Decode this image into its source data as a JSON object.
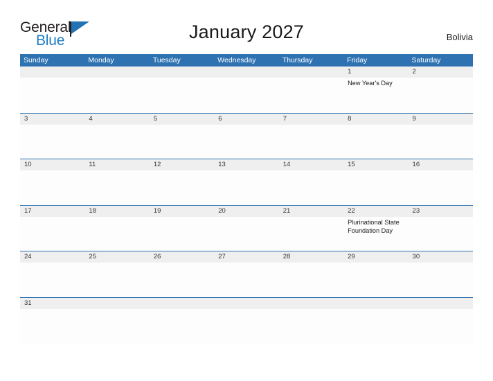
{
  "brand": {
    "name_part1": "General",
    "name_part2": "Blue",
    "colors": {
      "dark": "#231f20",
      "blue": "#1d7dc4"
    }
  },
  "header": {
    "title": "January 2027",
    "country": "Bolivia"
  },
  "calendar": {
    "accent_color": "#2e72b2",
    "number_band_color": "#efefef",
    "weekdays": [
      "Sunday",
      "Monday",
      "Tuesday",
      "Wednesday",
      "Thursday",
      "Friday",
      "Saturday"
    ],
    "weeks": [
      [
        {
          "day": "",
          "event": ""
        },
        {
          "day": "",
          "event": ""
        },
        {
          "day": "",
          "event": ""
        },
        {
          "day": "",
          "event": ""
        },
        {
          "day": "",
          "event": ""
        },
        {
          "day": "1",
          "event": "New Year's Day"
        },
        {
          "day": "2",
          "event": ""
        }
      ],
      [
        {
          "day": "3",
          "event": ""
        },
        {
          "day": "4",
          "event": ""
        },
        {
          "day": "5",
          "event": ""
        },
        {
          "day": "6",
          "event": ""
        },
        {
          "day": "7",
          "event": ""
        },
        {
          "day": "8",
          "event": ""
        },
        {
          "day": "9",
          "event": ""
        }
      ],
      [
        {
          "day": "10",
          "event": ""
        },
        {
          "day": "11",
          "event": ""
        },
        {
          "day": "12",
          "event": ""
        },
        {
          "day": "13",
          "event": ""
        },
        {
          "day": "14",
          "event": ""
        },
        {
          "day": "15",
          "event": ""
        },
        {
          "day": "16",
          "event": ""
        }
      ],
      [
        {
          "day": "17",
          "event": ""
        },
        {
          "day": "18",
          "event": ""
        },
        {
          "day": "19",
          "event": ""
        },
        {
          "day": "20",
          "event": ""
        },
        {
          "day": "21",
          "event": ""
        },
        {
          "day": "22",
          "event": "Plurinational State Foundation Day"
        },
        {
          "day": "23",
          "event": ""
        }
      ],
      [
        {
          "day": "24",
          "event": ""
        },
        {
          "day": "25",
          "event": ""
        },
        {
          "day": "26",
          "event": ""
        },
        {
          "day": "27",
          "event": ""
        },
        {
          "day": "28",
          "event": ""
        },
        {
          "day": "29",
          "event": ""
        },
        {
          "day": "30",
          "event": ""
        }
      ],
      [
        {
          "day": "31",
          "event": ""
        },
        {
          "day": "",
          "event": ""
        },
        {
          "day": "",
          "event": ""
        },
        {
          "day": "",
          "event": ""
        },
        {
          "day": "",
          "event": ""
        },
        {
          "day": "",
          "event": ""
        },
        {
          "day": "",
          "event": ""
        }
      ]
    ]
  }
}
